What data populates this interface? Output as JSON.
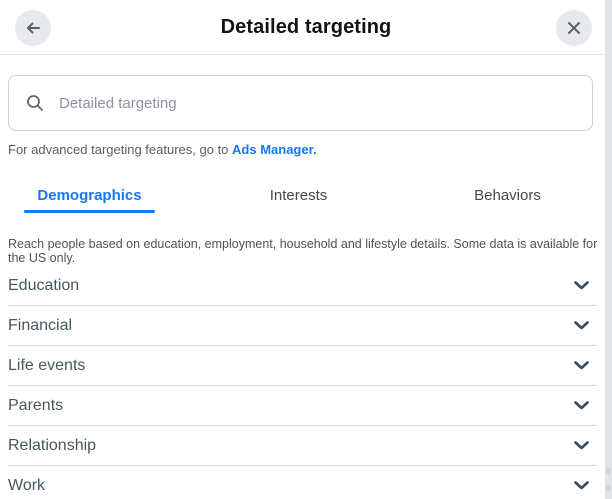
{
  "header": {
    "title": "Detailed targeting",
    "back_icon": "arrow-left",
    "close_icon": "x"
  },
  "search": {
    "placeholder": "Detailed targeting",
    "icon": "magnifier"
  },
  "helper": {
    "text_before_link": "For advanced targeting features, go to ",
    "link_label": "Ads Manager."
  },
  "tabs": [
    {
      "label": "Demographics",
      "active": true
    },
    {
      "label": "Interests",
      "active": false
    },
    {
      "label": "Behaviors",
      "active": false
    }
  ],
  "description": "Reach people based on education, employment, household and lifestyle details. Some data is available for the US only.",
  "categories": [
    {
      "label": "Education",
      "icon": "chevron-down"
    },
    {
      "label": "Financial",
      "icon": "chevron-down"
    },
    {
      "label": "Life events",
      "icon": "chevron-down"
    },
    {
      "label": "Parents",
      "icon": "chevron-down"
    },
    {
      "label": "Relationship",
      "icon": "chevron-down"
    },
    {
      "label": "Work",
      "icon": "chevron-down"
    }
  ],
  "colors": {
    "accent": "#1877f2",
    "divider": "#d9dbe0",
    "circle_button_bg": "#e7e9ec",
    "icon_gray": "#5b626d",
    "chevron": "#3a4b58",
    "list_text": "#465761",
    "placeholder": "#8c939e"
  }
}
